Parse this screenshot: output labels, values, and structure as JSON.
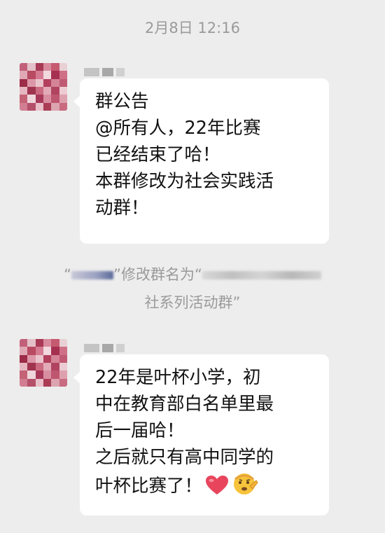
{
  "chat": {
    "timestamp": "2月8日 12:16",
    "messages": [
      {
        "lines": [
          "群公告",
          "@所有人，22年比赛",
          "已经结束了哈！",
          "本群修改为社会实践活",
          "动群！"
        ]
      },
      {
        "lines": [
          "22年是叶杯小学，初",
          "中在教育部白名单里最",
          "后一届哈！",
          "之后就只有高中同学的",
          "叶杯比赛了！"
        ],
        "emojis": [
          "red-heart-emoji",
          "salute-face-emoji"
        ]
      }
    ],
    "system_notice": {
      "quote_open": "“",
      "action": "”修改群名为“",
      "line2": "社系列活动群”"
    }
  },
  "colors": {
    "background": "#ededed",
    "bubble": "#ffffff",
    "system_text": "#9a9a9a",
    "heart": "#e8455d",
    "emoji_face": "#f6c33c"
  }
}
